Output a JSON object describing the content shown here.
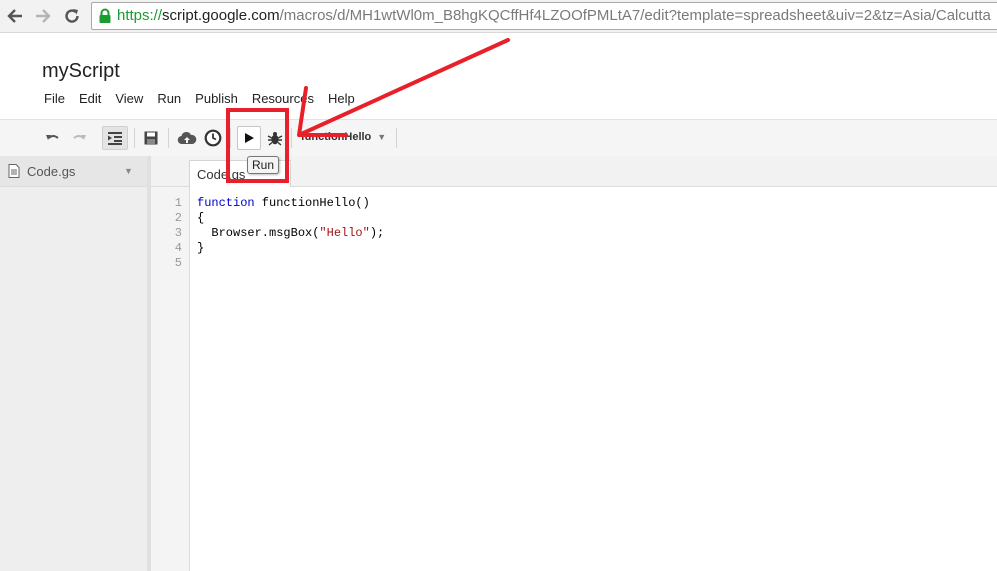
{
  "browser": {
    "url_scheme": "https://",
    "url_host": "script.google.com",
    "url_path": "/macros/d/MH1wtWl0m_B8hgKQCffHf4LZOOfPMLtA7/edit?template=spreadsheet&uiv=2&tz=Asia/Calcutta",
    "back_icon": "arrow-left-icon",
    "forward_icon": "arrow-right-icon",
    "reload_icon": "reload-icon",
    "lock_icon": "lock-icon"
  },
  "project": {
    "title": "myScript"
  },
  "menu": {
    "items": [
      "File",
      "Edit",
      "View",
      "Run",
      "Publish",
      "Resources",
      "Help"
    ]
  },
  "toolbar": {
    "icons": [
      "undo-icon",
      "redo-icon",
      "indent-icon",
      "save-icon",
      "cloud-icon",
      "clock-icon",
      "play-icon",
      "bug-icon"
    ],
    "function_selector": "functionHello",
    "tooltip": "Run"
  },
  "sidebar": {
    "file_name": "Code.gs"
  },
  "editor": {
    "tab_label": "Code.gs",
    "line_numbers": [
      "1",
      "2",
      "3",
      "4",
      "5"
    ],
    "lines": [
      {
        "kw": "function",
        "rest": " functionHello()"
      },
      {
        "pre": "{"
      },
      {
        "pre": "  Browser.msgBox(",
        "str": "\"Hello\"",
        "post": ");"
      },
      {
        "pre": "}"
      },
      {
        "pre": ""
      }
    ]
  },
  "colors": {
    "annotation": "#e8202a",
    "scheme_green": "#1a9c2f",
    "keyword_blue": "#0000cc",
    "string_red": "#a31515"
  }
}
